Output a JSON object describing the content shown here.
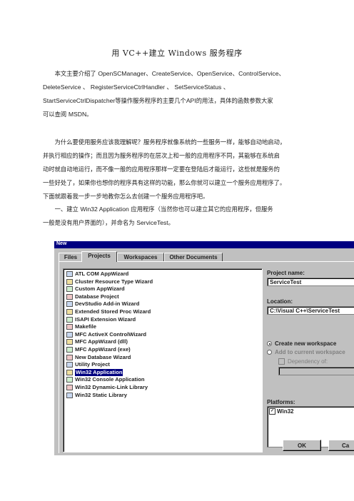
{
  "doc": {
    "title": "用  VC++建立  Windows  服务程序",
    "p1": {
      "line1_a": "本文主要介绍了",
      "line1_b": "OpenSCManager、CreateService、OpenService、ControlService、",
      "line2": [
        "DeleteService",
        "、",
        "RegisterServiceCtrlHandler",
        "、",
        "SetServiceStatus",
        "、"
      ],
      "line3_a": "StartServiceCtrlDispatcher",
      "line3_b": "等操作服务程序的主要几个",
      "line3_c": "API",
      "line3_d": "的用法，具体的函数参数大家",
      "line4_a": "可以查阅",
      "line4_b": "MSDN",
      "line4_c": "。"
    },
    "p2": {
      "line1": "为什么要使用服务应该我理解呢？服务程序就像系统的一些服务一样，能够自动地启动，",
      "line2": "并执行相应的操作；而且因为服务程序的在层次上和一般的应用程序不同，其能够在系统启",
      "line3": "动时就自动地运行，而不像一般的应用程序那样一定要在登陆后才能运行，这些就是服务的",
      "line4": "一些好处了，如果你也想你的程序具有这样的功能，那么你就可以建立一个服务应用程序了。",
      "line5": "下面就跟着我一步一步地教你怎么去创建一个服务应用程序吧。"
    },
    "p3": {
      "line1_a": "一、建立",
      "line1_b": "Win32 Application",
      "line1_c": "应用程序（当然你也可以建立其它的应用程序，但服务",
      "line2_a": "一般是没有用户界面的），并命名为",
      "line2_b": "ServiceTest",
      "line2_c": "。"
    }
  },
  "dialog": {
    "title": "New",
    "tabs": [
      "Files",
      "Projects",
      "Workspaces",
      "Other Documents"
    ],
    "active_tab": "Projects",
    "project_types": [
      "ATL COM AppWizard",
      "Cluster Resource Type Wizard",
      "Custom AppWizard",
      "Database Project",
      "DevStudio Add-in Wizard",
      "Extended Stored Proc Wizard",
      "ISAPI Extension Wizard",
      "Makefile",
      "MFC ActiveX ControlWizard",
      "MFC AppWizard (dll)",
      "MFC AppWizard (exe)",
      "New Database Wizard",
      "Utility Project",
      "Win32 Application",
      "Win32 Console Application",
      "Win32 Dynamic-Link Library",
      "Win32 Static Library"
    ],
    "selected_type": "Win32 Application",
    "project_name_label": "Project name:",
    "project_name_value": "ServiceTest",
    "location_label": "Location:",
    "location_value": "C:\\Visual C++\\ServiceTest",
    "radio_create": "Create new workspace",
    "radio_add": "Add to current workspace",
    "dependency_label": "Dependency of:",
    "platforms_label": "Platforms:",
    "platforms": [
      "Win32"
    ],
    "ok_label": "OK",
    "cancel_label": "Ca"
  },
  "colors": {
    "titlebar": "#000080",
    "dialog_face": "#c0c0c0",
    "selection": "#000080"
  }
}
